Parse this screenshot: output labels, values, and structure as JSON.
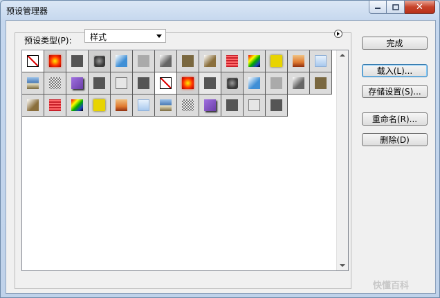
{
  "window": {
    "title": "预设管理器"
  },
  "caption": {
    "minimize": "—",
    "maximize": "□",
    "close": "✕"
  },
  "preset_type": {
    "label": "预设类型(P):",
    "value": "样式"
  },
  "buttons": {
    "done": "完成",
    "load": "载入(L)...",
    "save_set": "存储设置(S)...",
    "rename": "重命名(R)...",
    "delete": "删除(D)"
  },
  "watermark": "快懂百科",
  "swatches": [
    {
      "icon": "none-style-icon",
      "bg": "#ffffff",
      "fg": "#ffffff",
      "kind": "none"
    },
    {
      "icon": "red-glow-style-icon",
      "bg": "#d0d0d0",
      "fg": "#ff3300",
      "kind": "glow"
    },
    {
      "icon": "dark-square-style-icon",
      "bg": "#e8e8e8",
      "fg": "#555555",
      "kind": "flat"
    },
    {
      "icon": "dark-bevel-style-icon",
      "bg": "#cfcfcf",
      "fg": "#3a3a3a",
      "kind": "bevel"
    },
    {
      "icon": "blue-chrome-style-icon",
      "bg": "#dcdcdc",
      "fg": "#3f8fd6",
      "kind": "grad"
    },
    {
      "icon": "light-gray-style-icon",
      "bg": "#dcdcdc",
      "fg": "#aaaaaa",
      "kind": "flat"
    },
    {
      "icon": "gray-metal-style-icon",
      "bg": "#dcdcdc",
      "fg": "#666666",
      "kind": "grad"
    },
    {
      "icon": "brown-style-icon",
      "bg": "#dcdcdc",
      "fg": "#7a6840",
      "kind": "flat"
    },
    {
      "icon": "wood-style-icon",
      "bg": "#dcdcdc",
      "fg": "#8a6f3c",
      "kind": "grad"
    },
    {
      "icon": "red-stripe-style-icon",
      "bg": "#dcdcdc",
      "fg": "#c8202a",
      "kind": "stripe"
    },
    {
      "icon": "multicolor-style-icon",
      "bg": "#dcdcdc",
      "fg": "#2040c0",
      "kind": "multi"
    },
    {
      "icon": "yellow-style-icon",
      "bg": "#dcdcdc",
      "fg": "#e8d400",
      "kind": "glow2"
    },
    {
      "icon": "sunset-style-icon",
      "bg": "#dcdcdc",
      "fg": "#e07a30",
      "kind": "sunset"
    },
    {
      "icon": "sky-style-icon",
      "bg": "#dcdcdc",
      "fg": "#a8c8ee",
      "kind": "sky"
    },
    {
      "icon": "landscape-style-icon",
      "bg": "#dcdcdc",
      "fg": "#4f7fb8",
      "kind": "land"
    },
    {
      "icon": "noise-style-icon",
      "bg": "#dcdcdc",
      "fg": "#bbbbbb",
      "kind": "noise"
    },
    {
      "icon": "purple-shadow-style-icon",
      "bg": "#dcdcdc",
      "fg": "#6b3fa8",
      "kind": "shadow"
    },
    {
      "icon": "dark-square-style-icon",
      "bg": "#dcdcdc",
      "fg": "#555555",
      "kind": "flat"
    },
    {
      "icon": "light-outline-style-icon",
      "bg": "#dcdcdc",
      "fg": "#e6e6e6",
      "kind": "outline"
    },
    {
      "icon": "dark-square-style-icon",
      "bg": "#dcdcdc",
      "fg": "#555555",
      "kind": "flat"
    },
    {
      "icon": "none-style-icon",
      "bg": "#ffffff",
      "fg": "#ffffff",
      "kind": "none"
    },
    {
      "icon": "red-glow-style-icon",
      "bg": "#d0d0d0",
      "fg": "#ff3300",
      "kind": "glow"
    },
    {
      "icon": "dark-square-style-icon",
      "bg": "#e8e8e8",
      "fg": "#555555",
      "kind": "flat"
    },
    {
      "icon": "dark-bevel-style-icon",
      "bg": "#cfcfcf",
      "fg": "#3a3a3a",
      "kind": "bevel"
    },
    {
      "icon": "blue-chrome-style-icon",
      "bg": "#dcdcdc",
      "fg": "#3f8fd6",
      "kind": "grad"
    },
    {
      "icon": "light-gray-style-icon",
      "bg": "#dcdcdc",
      "fg": "#aaaaaa",
      "kind": "flat"
    },
    {
      "icon": "gray-metal-style-icon",
      "bg": "#dcdcdc",
      "fg": "#666666",
      "kind": "grad"
    },
    {
      "icon": "brown-style-icon",
      "bg": "#dcdcdc",
      "fg": "#7a6840",
      "kind": "flat"
    },
    {
      "icon": "wood-style-icon",
      "bg": "#dcdcdc",
      "fg": "#8a6f3c",
      "kind": "grad"
    },
    {
      "icon": "red-stripe-style-icon",
      "bg": "#dcdcdc",
      "fg": "#c8202a",
      "kind": "stripe"
    },
    {
      "icon": "multicolor-style-icon",
      "bg": "#dcdcdc",
      "fg": "#2040c0",
      "kind": "multi"
    },
    {
      "icon": "yellow-style-icon",
      "bg": "#dcdcdc",
      "fg": "#e8d400",
      "kind": "glow2"
    },
    {
      "icon": "sunset-style-icon",
      "bg": "#dcdcdc",
      "fg": "#e07a30",
      "kind": "sunset"
    },
    {
      "icon": "sky-style-icon",
      "bg": "#dcdcdc",
      "fg": "#a8c8ee",
      "kind": "sky"
    },
    {
      "icon": "landscape-style-icon",
      "bg": "#dcdcdc",
      "fg": "#4f7fb8",
      "kind": "land"
    },
    {
      "icon": "noise-style-icon",
      "bg": "#dcdcdc",
      "fg": "#bbbbbb",
      "kind": "noise"
    },
    {
      "icon": "purple-shadow-style-icon",
      "bg": "#dcdcdc",
      "fg": "#6b3fa8",
      "kind": "shadow"
    },
    {
      "icon": "dark-square-style-icon",
      "bg": "#dcdcdc",
      "fg": "#555555",
      "kind": "flat"
    },
    {
      "icon": "light-outline-style-icon",
      "bg": "#dcdcdc",
      "fg": "#e6e6e6",
      "kind": "outline"
    },
    {
      "icon": "dark-square-style-icon",
      "bg": "#dcdcdc",
      "fg": "#555555",
      "kind": "flat"
    }
  ]
}
